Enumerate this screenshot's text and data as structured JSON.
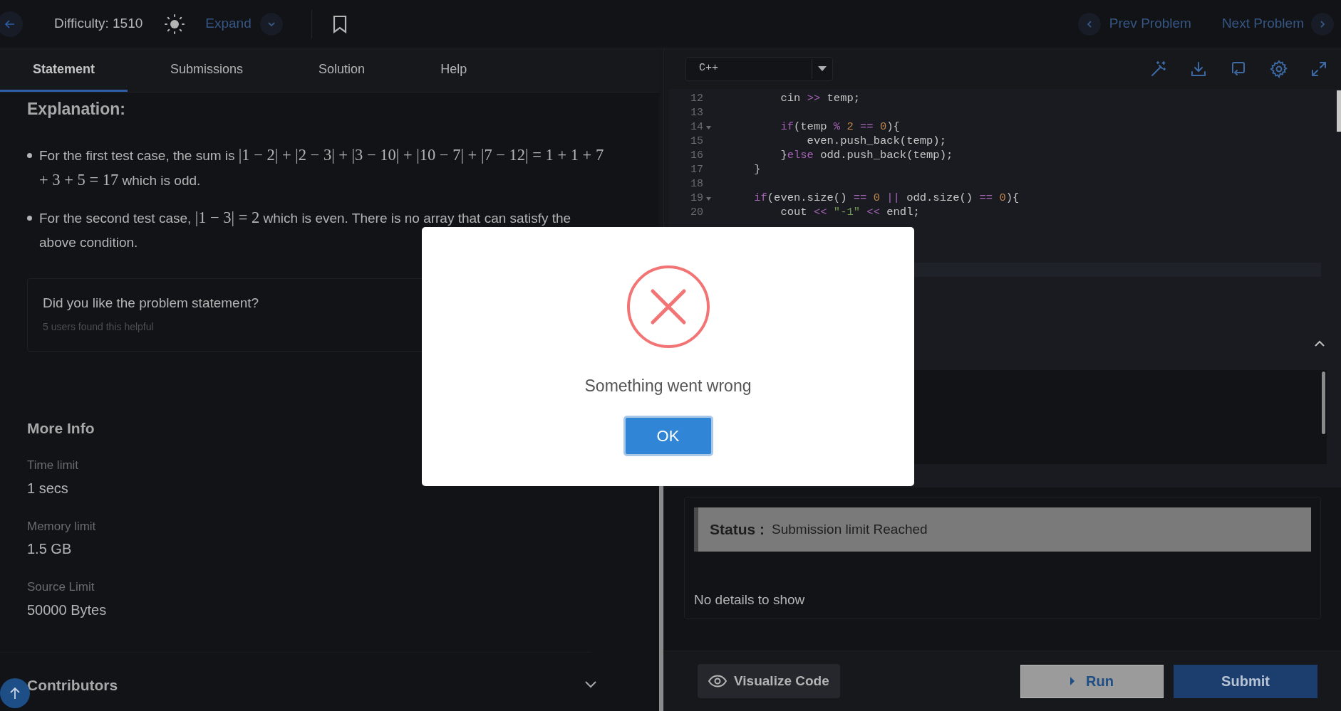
{
  "top_bar": {
    "difficulty": "Difficulty: 1510",
    "expand": "Expand",
    "prev": "Prev Problem",
    "next": "Next Problem"
  },
  "tabs": [
    {
      "label": "Statement",
      "selected": true
    },
    {
      "label": "Submissions",
      "selected": false
    },
    {
      "label": "Solution",
      "selected": false
    },
    {
      "label": "Help",
      "selected": false
    }
  ],
  "explanation": {
    "heading": "Explanation:",
    "bullets": [
      [
        {
          "kind": "text",
          "text": "For the first test case, the sum is "
        },
        {
          "kind": "math",
          "text": "|1 − 2| + |2 − 3| + |3 − 10| + |10 − 7| + |7 − 12| = 1 + 1 + 7 + 3 + 5 = 17"
        },
        {
          "kind": "text",
          "text": " which is odd."
        }
      ],
      [
        {
          "kind": "text",
          "text": "For the second test case, "
        },
        {
          "kind": "math",
          "text": "|1 − 3| = 2"
        },
        {
          "kind": "text",
          "text": " which is even. There is no array that can satisfy the above condition."
        }
      ]
    ]
  },
  "feedback": {
    "question": "Did you like the problem statement?",
    "count": "5 users found this helpful"
  },
  "more_info": {
    "heading": "More Info",
    "items": [
      {
        "label": "Time limit",
        "value": "1 secs"
      },
      {
        "label": "Memory limit",
        "value": "1.5 GB"
      },
      {
        "label": "Source Limit",
        "value": "50000 Bytes"
      }
    ]
  },
  "contributors": {
    "heading": "Contributors"
  },
  "editor": {
    "language": "C++",
    "lines": [
      {
        "number": "12",
        "fold": false,
        "tokens": [
          {
            "kind": "plain",
            "text": "        cin "
          },
          {
            "kind": "op",
            "text": ">>"
          },
          {
            "kind": "plain",
            "text": " temp;"
          }
        ]
      },
      {
        "number": "13",
        "fold": false
      },
      {
        "number": "14",
        "fold": true,
        "tokens": [
          {
            "kind": "kw",
            "text": "        if"
          },
          {
            "kind": "plain",
            "text": "(temp "
          },
          {
            "kind": "op",
            "text": "% "
          },
          {
            "kind": "num",
            "text": "2 "
          },
          {
            "kind": "op",
            "text": "== "
          },
          {
            "kind": "num",
            "text": "0"
          },
          {
            "kind": "plain",
            "text": "){"
          }
        ]
      },
      {
        "number": "15",
        "fold": false,
        "tokens": [
          {
            "kind": "plain",
            "text": "            even.push_back(temp);"
          }
        ]
      },
      {
        "number": "16",
        "fold": false,
        "tokens": [
          {
            "kind": "plain",
            "text": "        }"
          },
          {
            "kind": "kw",
            "text": "else"
          },
          {
            "kind": "plain",
            "text": " odd.push_back(temp);"
          }
        ]
      },
      {
        "number": "17",
        "fold": false,
        "tokens": [
          {
            "kind": "plain",
            "text": "    }"
          }
        ]
      },
      {
        "number": "18",
        "fold": false
      },
      {
        "number": "19",
        "fold": true,
        "tokens": [
          {
            "kind": "kw",
            "text": "    if"
          },
          {
            "kind": "plain",
            "text": "(even.size() "
          },
          {
            "kind": "op",
            "text": "== "
          },
          {
            "kind": "num",
            "text": "0 "
          },
          {
            "kind": "op",
            "text": "||"
          },
          {
            "kind": "plain",
            "text": " odd.size() "
          },
          {
            "kind": "op",
            "text": "== "
          },
          {
            "kind": "num",
            "text": "0"
          },
          {
            "kind": "plain",
            "text": "){"
          }
        ]
      },
      {
        "number": "20",
        "fold": false,
        "tokens": [
          {
            "kind": "plain",
            "text": "        cout "
          },
          {
            "kind": "op",
            "text": "<< "
          },
          {
            "kind": "str",
            "text": "\"-1\" "
          },
          {
            "kind": "op",
            "text": "<<"
          },
          {
            "kind": "plain",
            "text": " endl;"
          }
        ]
      }
    ]
  },
  "result": {
    "status_label": "Status :",
    "status": "Submission limit Reached",
    "details": "No details to show"
  },
  "actions": {
    "visualize": "Visualize Code",
    "run": "Run",
    "submit": "Submit"
  },
  "modal": {
    "message": "Something went wrong",
    "button": "OK"
  }
}
